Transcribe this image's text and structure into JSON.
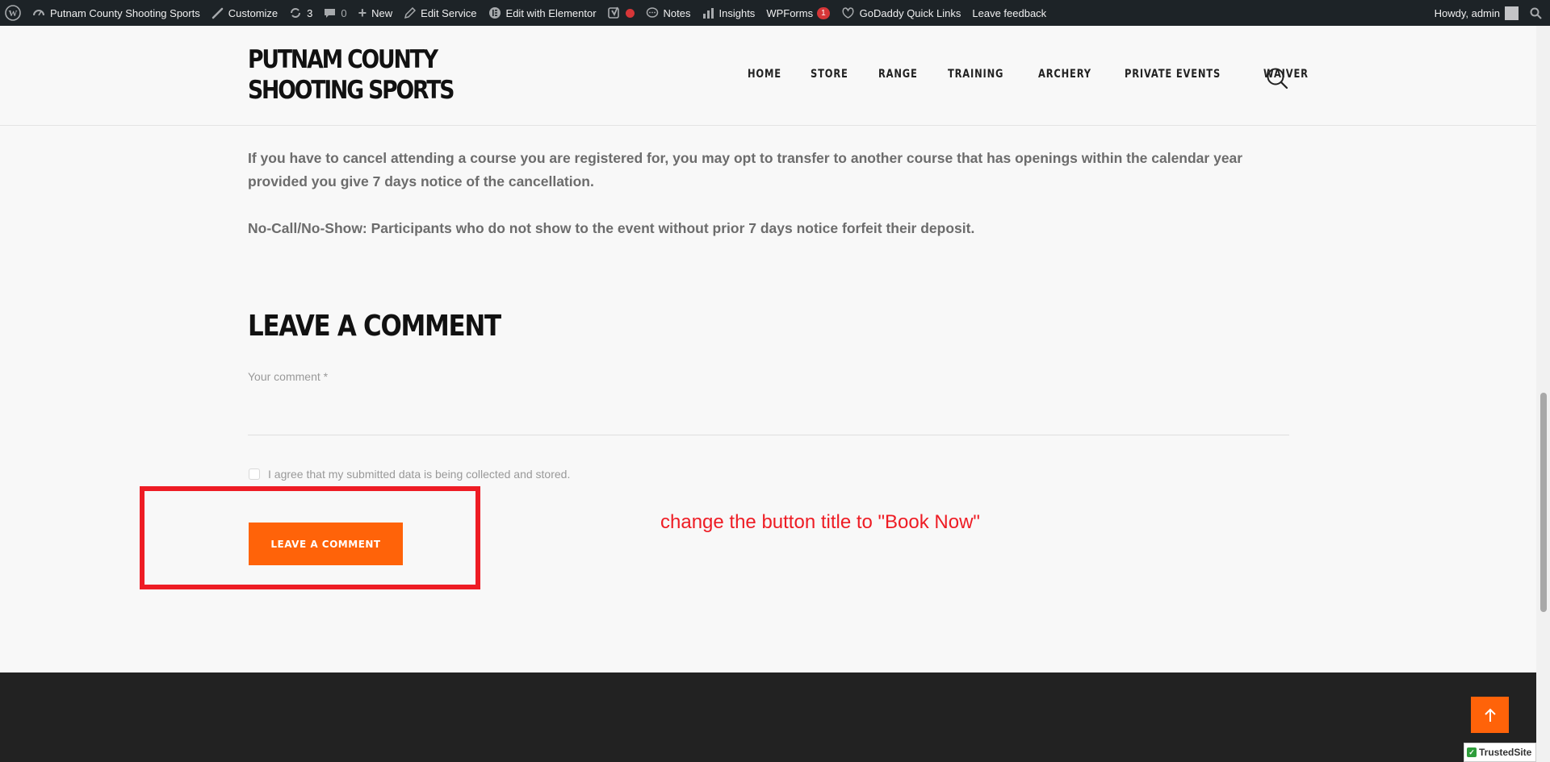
{
  "admin_bar": {
    "site_name": "Putnam County Shooting Sports",
    "customize": "Customize",
    "updates_count": "3",
    "comments_count": "0",
    "new": "New",
    "edit_service": "Edit Service",
    "edit_elementor": "Edit with Elementor",
    "notes": "Notes",
    "insights": "Insights",
    "wpforms": "WPForms",
    "wpforms_badge": "1",
    "godaddy": "GoDaddy Quick Links",
    "feedback": "Leave feedback",
    "howdy": "Howdy, admin"
  },
  "header": {
    "site_title_line1": "PUTNAM COUNTY",
    "site_title_line2": "SHOOTING SPORTS",
    "nav": [
      "HOME",
      "STORE",
      "RANGE",
      "TRAINING",
      "ARCHERY",
      "PRIVATE EVENTS",
      "WAIVER"
    ]
  },
  "content": {
    "para1": "If you have to cancel attending a course you are registered for, you may opt to transfer to another course that has openings within the calendar year provided you give 7 days notice of the cancellation.",
    "para2": "No-Call/No-Show: Participants who do not show to the event without prior 7 days notice forfeit their deposit."
  },
  "comment_form": {
    "title": "LEAVE A COMMENT",
    "comment_label": "Your comment *",
    "consent_label": "I agree that my submitted data is being collected and stored.",
    "consent_checked": false,
    "submit_label": "LEAVE A COMMENT"
  },
  "annotation": {
    "text": "change the button title to \"Book Now\"",
    "color": "#ee1c24"
  },
  "footer": {
    "scroll_top_icon": "arrow-up-icon",
    "trusted_site": "TrustedSite"
  },
  "colors": {
    "accent": "#ff6309",
    "admin_bar": "#1d2327",
    "footer": "#222222"
  }
}
